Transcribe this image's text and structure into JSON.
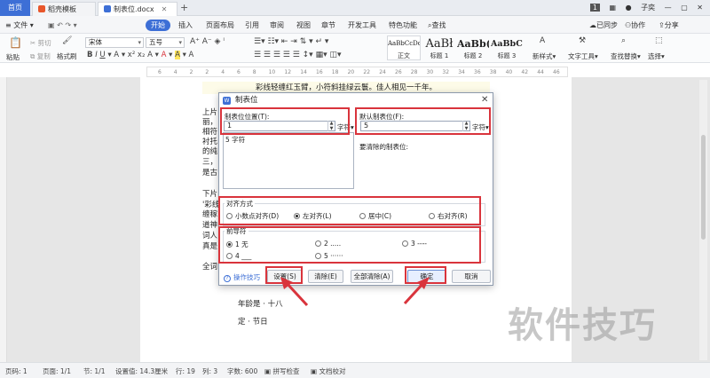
{
  "tabs": {
    "home": "首页",
    "t1": "稻壳模板",
    "t2": "制表位.docx",
    "page_num": "1",
    "user": "子奕"
  },
  "menu": {
    "file": "文件",
    "items": [
      "开始",
      "插入",
      "页面布局",
      "引用",
      "审阅",
      "视图",
      "章节",
      "开发工具",
      "特色功能"
    ],
    "search": "查找",
    "sync": "已同步",
    "collab": "协作",
    "share": "分享"
  },
  "ribbon": {
    "paste": "粘贴",
    "cut": "剪切",
    "copy": "复制",
    "format_painter": "格式刷",
    "font": "宋体",
    "size": "五号",
    "styles": [
      {
        "sample": "AaBbCcDd",
        "name": "正文"
      },
      {
        "sample": "AaBł",
        "name": "标题 1"
      },
      {
        "sample": "AaBb(",
        "name": "标题 2"
      },
      {
        "sample": "AaBbC(",
        "name": "标题 3"
      }
    ],
    "new_style": "新样式",
    "text_tools": "文字工具",
    "find_replace": "查找替换",
    "select": "选择"
  },
  "ruler": [
    "6",
    "4",
    "2",
    "2",
    "4",
    "6",
    "8",
    "10",
    "12",
    "14",
    "16",
    "18",
    "20",
    "22",
    "24",
    "26",
    "28",
    "30",
    "32",
    "34",
    "36",
    "38",
    "40",
    "42",
    "44",
    "46"
  ],
  "document": {
    "banner": "彩线轻缠红玉臂，小符斜挂绿云鬟。佳人相见一千年。",
    "left_lines": [
      "上片",
      "丽，",
      "相符",
      "衬托",
      "的纯",
      "三，",
      "是古",
      "下片",
      "'彩线",
      "缠稼",
      "道神",
      "词人",
      "真是",
      "全词"
    ],
    "bottom_lines": [
      "年龄是 · 十八",
      "定 · 节日"
    ]
  },
  "watermark": "软件技巧",
  "status": {
    "page": "页码: 1",
    "pages": "页面: 1/1",
    "section": "节: 1/1",
    "setting": "设置值: 14.3厘米",
    "row": "行: 19",
    "col": "列: 3",
    "words": "字数: 600",
    "spell": "拼写检查",
    "proof": "文档校对"
  },
  "dialog": {
    "title": "制表位",
    "tab_pos_label": "制表位位置(T):",
    "tab_pos_value": "1",
    "unit1": "字符",
    "default_label": "默认制表位(F):",
    "default_value": "5",
    "unit2": "字符",
    "list_item": "5 字符",
    "clear_label": "要清除的制表位:",
    "align_title": "对齐方式",
    "align_options": [
      "小数点对齐(D)",
      "左对齐(L)",
      "居中(C)",
      "右对齐(R)"
    ],
    "align_selected": 1,
    "leader_title": "前导符",
    "leader_options": [
      "1 无",
      "2 .....",
      "3 ----",
      "4 ___",
      "5 ······"
    ],
    "leader_selected": 0,
    "help": "操作技巧",
    "buttons": {
      "set": "设置(S)",
      "clear": "清除(E)",
      "clear_all": "全部清除(A)",
      "ok": "确定",
      "cancel": "取消"
    }
  },
  "colors": {
    "accent": "#3d6fd6",
    "highlight": "#d9343c"
  }
}
